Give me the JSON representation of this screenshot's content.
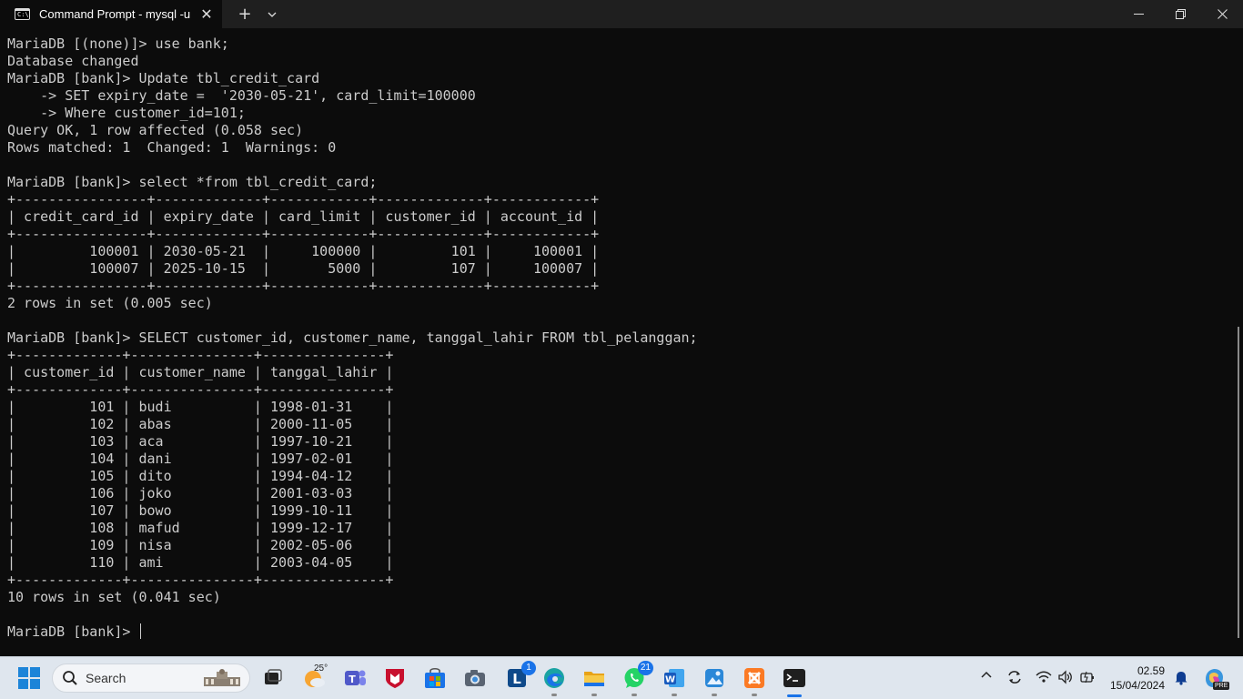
{
  "window": {
    "tab_title": "Command Prompt - mysql  -u",
    "tab_icon_text": "C:\\",
    "close_glyph": "✕",
    "new_tab_glyph": "+",
    "minimize_glyph": "—",
    "maximize_glyph": "❐",
    "window_close_glyph": "✕"
  },
  "terminal": {
    "lines": [
      "MariaDB [(none)]> use bank;",
      "Database changed",
      "MariaDB [bank]> Update tbl_credit_card",
      "    -> SET expiry_date =  '2030-05-21', card_limit=100000",
      "    -> Where customer_id=101;",
      "Query OK, 1 row affected (0.058 sec)",
      "Rows matched: 1  Changed: 1  Warnings: 0",
      "",
      "MariaDB [bank]> select *from tbl_credit_card;",
      "+----------------+-------------+------------+-------------+------------+",
      "| credit_card_id | expiry_date | card_limit | customer_id | account_id |",
      "+----------------+-------------+------------+-------------+------------+",
      "|         100001 | 2030-05-21  |     100000 |         101 |     100001 |",
      "|         100007 | 2025-10-15  |       5000 |         107 |     100007 |",
      "+----------------+-------------+------------+-------------+------------+",
      "2 rows in set (0.005 sec)",
      "",
      "MariaDB [bank]> SELECT customer_id, customer_name, tanggal_lahir FROM tbl_pelanggan;",
      "+-------------+---------------+---------------+",
      "| customer_id | customer_name | tanggal_lahir |",
      "+-------------+---------------+---------------+",
      "|         101 | budi          | 1998-01-31    |",
      "|         102 | abas          | 2000-11-05    |",
      "|         103 | aca           | 1997-10-21    |",
      "|         104 | dani          | 1997-02-01    |",
      "|         105 | dito          | 1994-04-12    |",
      "|         106 | joko          | 2001-03-03    |",
      "|         107 | bowo          | 1999-10-11    |",
      "|         108 | mafud         | 1999-12-17    |",
      "|         109 | nisa          | 2002-05-06    |",
      "|         110 | ami           | 2003-04-05    |",
      "+-------------+---------------+---------------+",
      "10 rows in set (0.041 sec)"
    ],
    "prompt": "MariaDB [bank]> ",
    "colors": {
      "background": "#0c0c0c",
      "text": "#cccccc"
    }
  },
  "taskbar": {
    "search_label": "Search",
    "weather_temp": "25°",
    "badges": {
      "outlook": "1",
      "whatsapp": "21"
    },
    "clock_time": "02.59",
    "clock_date": "15/04/2024",
    "copilot_tag": "PRE",
    "icons": [
      "start-icon",
      "search-icon",
      "task-view-icon",
      "weather-icon",
      "teams-icon",
      "mcafee-icon",
      "store-icon",
      "camera-icon",
      "outlook-icon",
      "edge-icon",
      "file-explorer-icon",
      "whatsapp-icon",
      "word-icon",
      "photos-icon",
      "xampp-icon",
      "terminal-icon"
    ]
  }
}
